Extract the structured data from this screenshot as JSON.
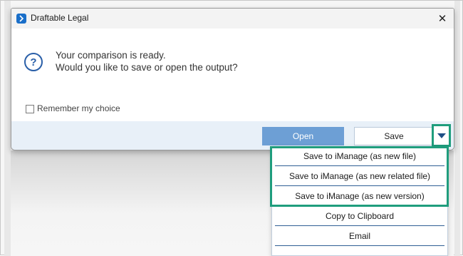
{
  "window": {
    "title": "Draftable Legal",
    "close_glyph": "✕"
  },
  "message": {
    "line1": "Your comparison is ready.",
    "line2": "Would you like to save or open the output?",
    "icon": "question-icon"
  },
  "remember": {
    "label": "Remember my choice",
    "checked": false
  },
  "buttons": {
    "open_label": "Open",
    "save_label": "Save"
  },
  "menu": {
    "items": [
      {
        "label": "Save to iManage (as new file)"
      },
      {
        "label": "Save to iManage (as new related file)"
      },
      {
        "label": "Save to iManage (as new version)"
      },
      {
        "label": "Copy to Clipboard"
      },
      {
        "label": "Email"
      }
    ]
  },
  "colors": {
    "accent": "#6d9fd5",
    "highlight": "#1f9d7d",
    "footer_bg": "#e8f0f8"
  }
}
